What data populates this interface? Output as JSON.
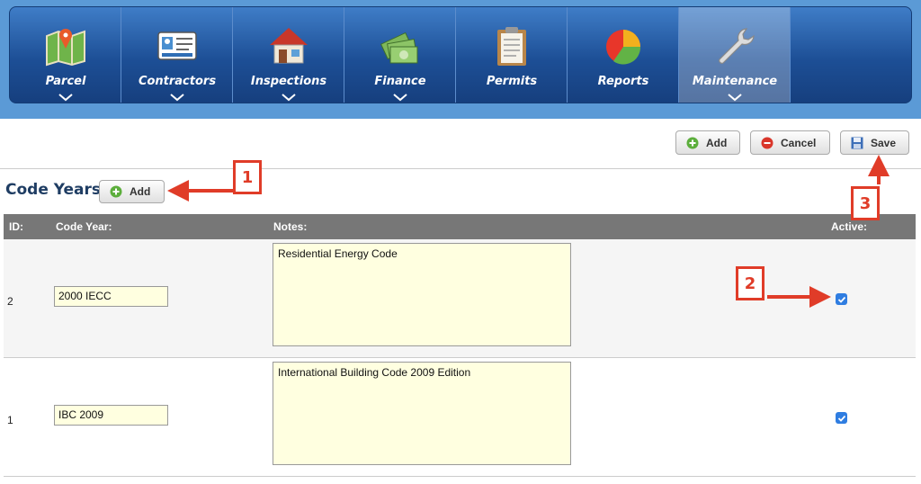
{
  "nav": {
    "items": [
      {
        "label": "Parcel",
        "icon": "map-icon"
      },
      {
        "label": "Contractors",
        "icon": "id-card-icon"
      },
      {
        "label": "Inspections",
        "icon": "house-icon"
      },
      {
        "label": "Finance",
        "icon": "money-icon"
      },
      {
        "label": "Permits",
        "icon": "clipboard-icon"
      },
      {
        "label": "Reports",
        "icon": "pie-chart-icon"
      },
      {
        "label": "Maintenance",
        "icon": "wrench-icon",
        "active": true
      }
    ]
  },
  "toolbar": {
    "add_label": "Add",
    "cancel_label": "Cancel",
    "save_label": "Save"
  },
  "section": {
    "title": "Code Years",
    "add_label": "Add"
  },
  "table": {
    "headers": {
      "id": "ID:",
      "code_year": "Code Year:",
      "notes": "Notes:",
      "active": "Active:"
    },
    "rows": [
      {
        "id": "2",
        "code_year": "2000 IECC",
        "notes": "Residential Energy Code",
        "active": true
      },
      {
        "id": "1",
        "code_year": "IBC 2009",
        "notes": "International Building Code 2009 Edition",
        "active": true
      }
    ]
  },
  "annotations": {
    "callout_1": "1",
    "callout_2": "2",
    "callout_3": "3"
  },
  "colors": {
    "nav_bg": "#1d4f96",
    "band_bg": "#5b9ad6",
    "annotation": "#e03c28",
    "checkbox": "#2f7de1",
    "input_bg": "#ffffe0"
  }
}
